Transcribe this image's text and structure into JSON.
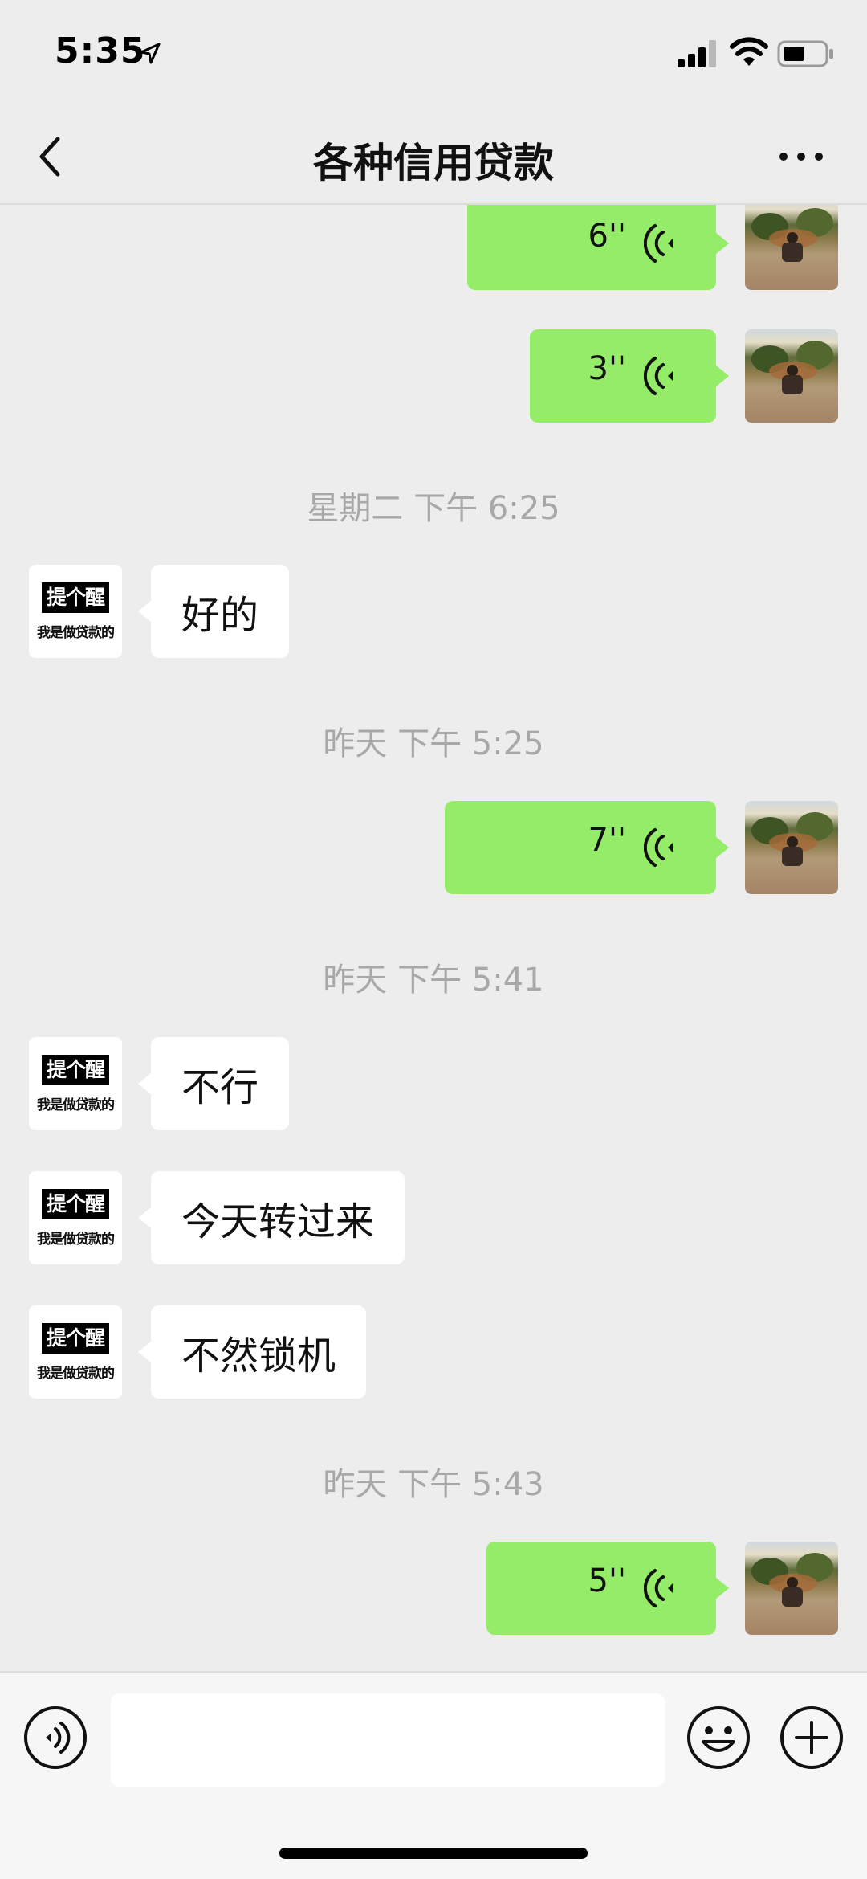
{
  "status_bar": {
    "time": "5:35"
  },
  "nav": {
    "title": "各种信用贷款"
  },
  "avatar_card": {
    "top_text": "提个醒",
    "bottom_text": "我是做贷款的"
  },
  "messages": [
    {
      "kind": "voice",
      "side": "right",
      "duration": "6''"
    },
    {
      "kind": "voice",
      "side": "right",
      "duration": "3''"
    },
    {
      "kind": "time",
      "text": "星期二 下午 6:25"
    },
    {
      "kind": "text",
      "side": "left",
      "text": "好的"
    },
    {
      "kind": "time",
      "text": "昨天 下午 5:25"
    },
    {
      "kind": "voice",
      "side": "right",
      "duration": "7''"
    },
    {
      "kind": "time",
      "text": "昨天 下午 5:41"
    },
    {
      "kind": "text",
      "side": "left",
      "text": "不行"
    },
    {
      "kind": "text",
      "side": "left",
      "text": "今天转过来"
    },
    {
      "kind": "text",
      "side": "left",
      "text": "不然锁机"
    },
    {
      "kind": "time",
      "text": "昨天 下午 5:43"
    },
    {
      "kind": "voice",
      "side": "right",
      "duration": "5''"
    }
  ],
  "input": {
    "value": ""
  },
  "colors": {
    "bubble_mine": "#95ec69",
    "bubble_theirs": "#ffffff",
    "background": "#ededed"
  },
  "icons": [
    "location-arrow-icon",
    "signal-icon",
    "wifi-icon",
    "battery-icon",
    "back-chevron-icon",
    "more-icon",
    "voice-playback-icon",
    "voice-input-icon",
    "emoji-icon",
    "plus-icon"
  ]
}
